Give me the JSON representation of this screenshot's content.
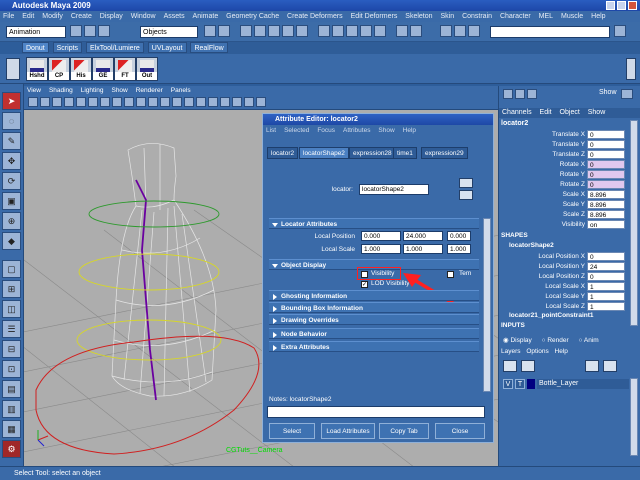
{
  "window": {
    "title": "Autodesk Maya 2009"
  },
  "menubar": [
    "File",
    "Edit",
    "Modify",
    "Create",
    "Display",
    "Window",
    "Assets",
    "Animate",
    "Geometry Cache",
    "Create Deformers",
    "Edit Deformers",
    "Skeleton",
    "Skin",
    "Constrain",
    "Character",
    "MEL",
    "Muscle",
    "Help"
  ],
  "statusline": {
    "mode": "Animation",
    "select_field": "Objects"
  },
  "shelf": {
    "tabs": [
      "Donut",
      "Scripts",
      "ElxTool/Lumiere",
      "UVLayout",
      "RealFlow"
    ],
    "active_tab": "Donut",
    "buttons": [
      "Hshd",
      "CP",
      "His",
      "GE",
      "FT",
      "Out"
    ]
  },
  "viewport": {
    "menu": [
      "View",
      "Shading",
      "Lighting",
      "Show",
      "Renderer",
      "Panels"
    ],
    "camera_label": "CGTuts__Camera"
  },
  "attribute_editor": {
    "title": "Attribute Editor: locator2",
    "menu": [
      "List",
      "Selected",
      "Focus",
      "Attributes",
      "Show",
      "Help"
    ],
    "tabs": [
      "locator2",
      "locatorShape2",
      "expression28",
      "time1",
      "expression29"
    ],
    "active_tab": "locatorShape2",
    "locator_label": "locator:",
    "locator_value": "locatorShape2",
    "sections": {
      "locator_attributes": "Locator Attributes",
      "object_display": "Object Display",
      "ghosting": "Ghosting Information",
      "bounding_box": "Bounding Box Information",
      "drawing_overrides": "Drawing Overrides",
      "node_behavior": "Node Behavior",
      "extra": "Extra Attributes"
    },
    "local_position": {
      "label": "Local Position",
      "values": [
        "0.000",
        "24.000",
        "0.000"
      ]
    },
    "local_scale": {
      "label": "Local Scale",
      "values": [
        "1.000",
        "1.000",
        "1.000"
      ]
    },
    "visibility_label": "Visibility",
    "visibility_checked": false,
    "lod_label": "LOD Visibility",
    "lod_checked": true,
    "template_label": "Tem",
    "notes_label": "Notes:  locatorShape2",
    "notes_value": "",
    "buttons": [
      "Select",
      "Load Attributes",
      "Copy Tab",
      "Close"
    ]
  },
  "channel_box": {
    "menu": [
      "Channels",
      "Edit",
      "Object",
      "Show"
    ],
    "object": "locator2",
    "channels": [
      {
        "name": "Translate X",
        "value": "0"
      },
      {
        "name": "Translate Y",
        "value": "0"
      },
      {
        "name": "Translate Z",
        "value": "0"
      },
      {
        "name": "Rotate X",
        "value": "0"
      },
      {
        "name": "Rotate Y",
        "value": "0"
      },
      {
        "name": "Rotate Z",
        "value": "0"
      },
      {
        "name": "Scale X",
        "value": "8.896"
      },
      {
        "name": "Scale Y",
        "value": "8.896"
      },
      {
        "name": "Scale Z",
        "value": "8.896"
      },
      {
        "name": "Visibility",
        "value": "on"
      }
    ],
    "shapes_header": "SHAPES",
    "shape_name": "locatorShape2",
    "shape_channels": [
      {
        "name": "Local Position X",
        "value": "0"
      },
      {
        "name": "Local Position Y",
        "value": "24"
      },
      {
        "name": "Local Position Z",
        "value": "0"
      },
      {
        "name": "Local Scale X",
        "value": "1"
      },
      {
        "name": "Local Scale Y",
        "value": "1"
      },
      {
        "name": "Local Scale Z",
        "value": "1"
      }
    ],
    "constraint": "locator21_pointConstraint1",
    "inputs_header": "INPUTS",
    "layer_modes": [
      "Display",
      "Render",
      "Anim"
    ],
    "layer_menu": [
      "Layers",
      "Options",
      "Help"
    ],
    "layer": {
      "v": "V",
      "t": "T",
      "name": "Bottle_Layer"
    }
  },
  "helpline": "Select Tool: select an object",
  "colors": {
    "ui": "#3a6aa8",
    "viewport": "#adadad",
    "annotation": "#ff2020"
  },
  "icons": [
    "select-arrow-icon",
    "lasso-icon",
    "paint-icon",
    "move-icon",
    "rotate-icon",
    "scale-icon"
  ]
}
